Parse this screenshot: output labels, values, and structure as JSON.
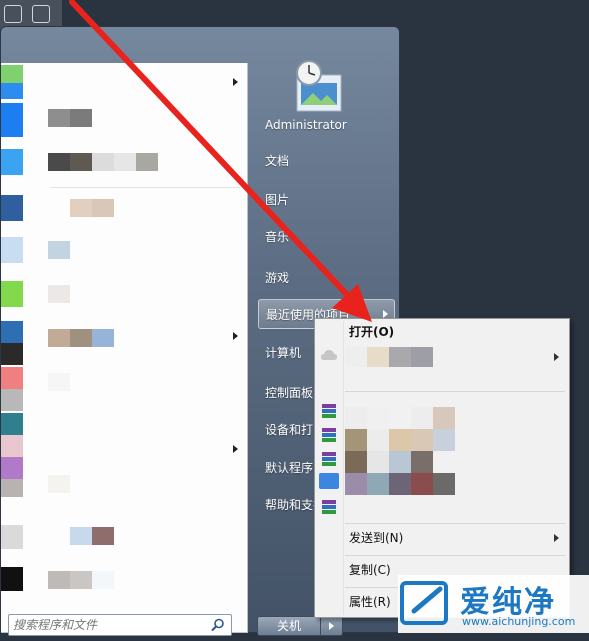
{
  "right_pane": {
    "user": "Administrator",
    "documents": "文档",
    "pictures": "图片",
    "music": "音乐",
    "games": "游戏",
    "recent_items": "最近使用的项目",
    "computer": "计算机",
    "control_panel": "控制面板",
    "devices_printers": "设备和打印机",
    "default_programs": "默认程序",
    "help_support": "帮助和支持"
  },
  "search": {
    "placeholder": "搜索程序和文件"
  },
  "shutdown": {
    "label": "关机"
  },
  "context_menu": {
    "open": "打开(O)",
    "send_to": "发送到(N)",
    "copy": "复制(C)",
    "properties": "属性(R)"
  },
  "watermark": {
    "title": "爱纯净",
    "url": "www.aichunjing.com"
  },
  "colors": {
    "annotation_arrow": "#e8231e",
    "menu_bg": "#f1f1f1",
    "start_menu_blue": "#5d6e84",
    "watermark_blue": "#1c78c2"
  },
  "icons": [
    "user-picture-icon",
    "search-icon",
    "skydrive-icon",
    "winrar-archive-icon",
    "folder-icon",
    "submenu-arrow-icon"
  ]
}
